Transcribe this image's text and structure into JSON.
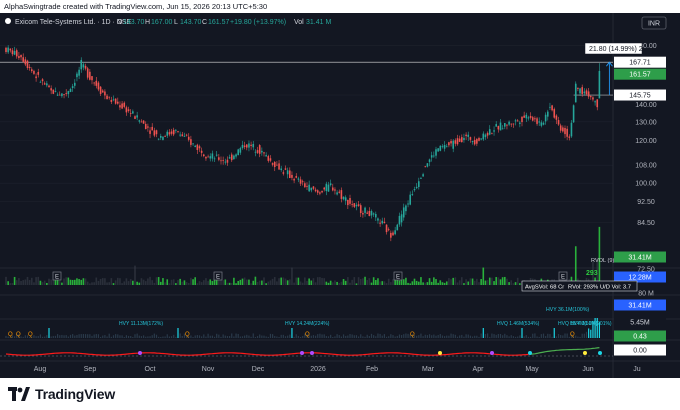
{
  "header": {
    "attribution": "AlphaSwingtrade created with TradingView.com, Jun 15, 2026 20:13 UTC+5:30"
  },
  "legend": {
    "symbol": "Exicom Tele-Systems Ltd. · 1D · NSE",
    "o_label": "O",
    "o_value": "143.70",
    "h_label": "H",
    "h_value": "167.00",
    "l_label": "L",
    "l_value": "143.70",
    "c_label": "C",
    "c_value": "161.57",
    "change": "+19.80 (+13.97%)",
    "vol_label": "Vol",
    "vol_value": "31.41 M"
  },
  "currency": "INR",
  "measure_label": "21.80 (14.99%) 2",
  "price_axis": {
    "ticks": [
      "180.00",
      "167.71",
      "161.57",
      "145.75",
      "140.00",
      "130.00",
      "120.00",
      "108.00",
      "100.00",
      "92.50",
      "84.50",
      "31.41M",
      "72.50",
      "12.28M",
      "80 M",
      "31.41M",
      "5.45M",
      "0.43",
      "0.00"
    ]
  },
  "price_badges": {
    "resistance": "167.71",
    "last": "161.57",
    "support": "145.75",
    "volume_last": "31.41M",
    "volume_avg": "12.28M",
    "ind_vol": "31.41M",
    "ind_avg": "5.45M",
    "osc_last": "0.43",
    "osc_zero": "0.00"
  },
  "annotations": {
    "rvol_tag": "RVOL (9)",
    "rvol_value": "293",
    "hvy_recent": "HVY 36.1M(100%)",
    "stats": {
      "avg_vol": "AvgSVol: 68 Cr",
      "rvol": "RVol: 293%",
      "ud_vol": "U/D Vol: 3.7"
    },
    "volume_notes": [
      {
        "text": "HVY 11.13M(172%)",
        "x": 119
      },
      {
        "text": "HVY 14.24M(224%)",
        "x": 285
      },
      {
        "text": "HVQ 1.46M(534%)",
        "x": 497
      },
      {
        "text": "HVQ 18.4M(50%)",
        "x": 558
      },
      {
        "text": "HVY 36.1M(201%)",
        "x": 570
      }
    ],
    "earnings_markers": [
      "E",
      "E",
      "E",
      "E"
    ],
    "q_marker": "Q"
  },
  "x_axis": {
    "labels": [
      "Aug",
      "Sep",
      "Oct",
      "Nov",
      "Dec",
      "2026",
      "Feb",
      "Mar",
      "Apr",
      "May",
      "Jun",
      "Ju"
    ]
  },
  "footer": {
    "brand": "TradingView"
  },
  "colors": {
    "up": "#26a69a",
    "up_bright": "#2ecc40",
    "down": "#ef5350",
    "background": "#131722",
    "resistance": "#ffffff",
    "support": "#2196f3",
    "accent_cyan": "#1cd6e6",
    "osc_red": "#ff1a1a",
    "osc_green": "#4caf50",
    "osc_purple": "#b04cff"
  },
  "chart_data": {
    "type": "candlestick",
    "symbol": "Exicom Tele-Systems Ltd., 1D, NSE",
    "y_scale": "log",
    "ylim": [
      72,
      190
    ],
    "months": [
      "Aug",
      "Sep",
      "Oct",
      "Nov",
      "Dec",
      "2026",
      "Feb",
      "Mar",
      "Apr",
      "May",
      "Jun"
    ],
    "path_points": [
      [
        0,
        178
      ],
      [
        8,
        172
      ],
      [
        15,
        158
      ],
      [
        22,
        148
      ],
      [
        28,
        146
      ],
      [
        32,
        152
      ],
      [
        36,
        166
      ],
      [
        42,
        154
      ],
      [
        48,
        144
      ],
      [
        56,
        138
      ],
      [
        64,
        130
      ],
      [
        72,
        122
      ],
      [
        80,
        125
      ],
      [
        88,
        118
      ],
      [
        96,
        112
      ],
      [
        104,
        110
      ],
      [
        112,
        118
      ],
      [
        118,
        116
      ],
      [
        124,
        110
      ],
      [
        132,
        104
      ],
      [
        140,
        99
      ],
      [
        146,
        96
      ],
      [
        152,
        99
      ],
      [
        158,
        94
      ],
      [
        164,
        90
      ],
      [
        170,
        88
      ],
      [
        176,
        84
      ],
      [
        180,
        80
      ],
      [
        184,
        86
      ],
      [
        190,
        96
      ],
      [
        196,
        108
      ],
      [
        202,
        116
      ],
      [
        208,
        118
      ],
      [
        214,
        122
      ],
      [
        220,
        120
      ],
      [
        226,
        125
      ],
      [
        232,
        128
      ],
      [
        238,
        130
      ],
      [
        244,
        134
      ],
      [
        250,
        128
      ],
      [
        254,
        140
      ],
      [
        258,
        128
      ],
      [
        263,
        122
      ],
      [
        266,
        150
      ],
      [
        272,
        146
      ],
      [
        276,
        140
      ]
    ],
    "last": {
      "open": 143.7,
      "high": 167.0,
      "low": 143.7,
      "close": 161.57,
      "change": 19.8,
      "change_pct": 13.97,
      "volume": "31.41M"
    },
    "levels": {
      "resistance": 167.71,
      "support": 145.75
    },
    "volume_range": [
      0,
      80
    ],
    "volume_avg": 12.28
  }
}
